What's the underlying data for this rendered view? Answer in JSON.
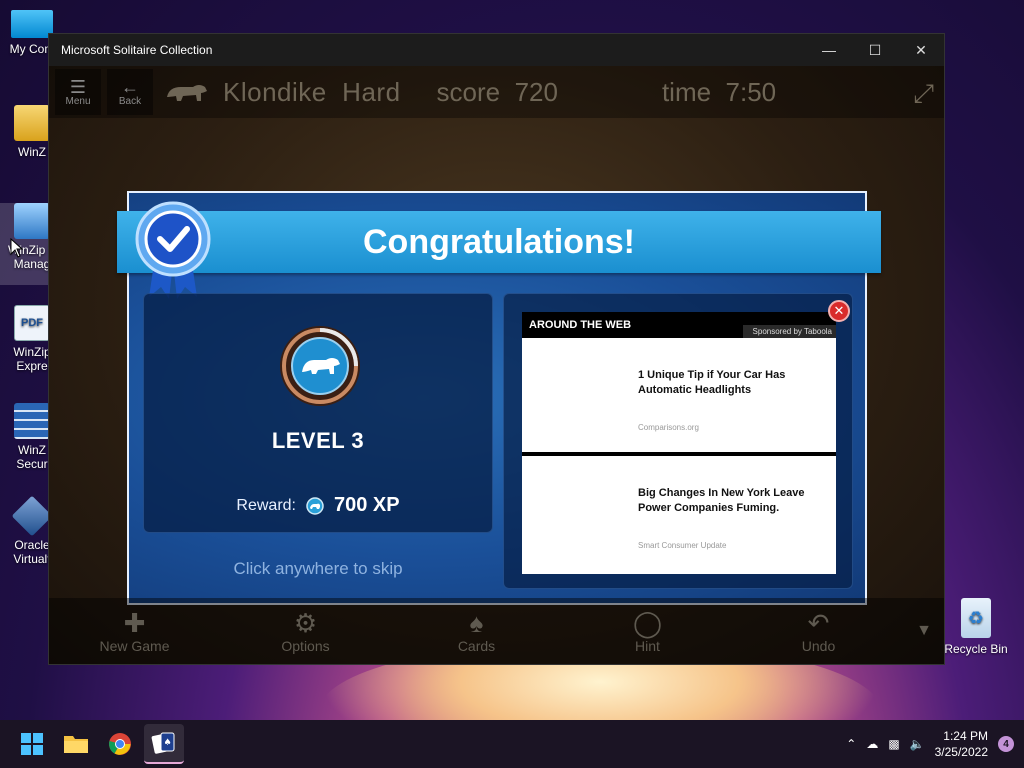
{
  "desktop": {
    "icons": [
      {
        "label": "My Com",
        "icon": "computer-icon"
      },
      {
        "label": "WinZ",
        "icon": "winzip-icon"
      },
      {
        "label": "WinZip Ir\nManag",
        "icon": "winzip-image-manager-icon"
      },
      {
        "label": "WinZip\nExpre",
        "icon": "pdf-icon"
      },
      {
        "label": "WinZ\nSecur",
        "icon": "winzip-secure-icon"
      },
      {
        "label": "Oracle\nVirtualt",
        "icon": "virtualbox-icon"
      }
    ],
    "recycle_bin": "Recycle Bin"
  },
  "window": {
    "title": "Microsoft Solitaire Collection"
  },
  "game": {
    "menu_label": "Menu",
    "back_label": "Back",
    "mode": "Klondike  Hard",
    "score": "score  720",
    "time": "time  7:50",
    "bottom": {
      "new_game": "New Game",
      "options": "Options",
      "cards": "Cards",
      "hint": "Hint",
      "undo": "Undo"
    }
  },
  "modal": {
    "title": "Congratulations!",
    "level": "LEVEL 3",
    "reward_label": "Reward:",
    "reward_value": "700 XP",
    "skip": "Click anywhere to skip",
    "ad": {
      "header": "AROUND THE WEB",
      "sponsor": "Sponsored by Taboola",
      "items": [
        {
          "title": "1 Unique Tip if Your Car Has Automatic Headlights",
          "source": "Comparisons.org"
        },
        {
          "title": "Big Changes In New York Leave Power Companies Fuming.",
          "source": "Smart Consumer Update"
        }
      ]
    }
  },
  "taskbar": {
    "time": "1:24 PM",
    "date": "3/25/2022",
    "notifications": "4"
  },
  "colors": {
    "ribbon": "#2aa4e2",
    "modal_bg": "#1a4f98",
    "ad_close": "#d92b2b"
  }
}
